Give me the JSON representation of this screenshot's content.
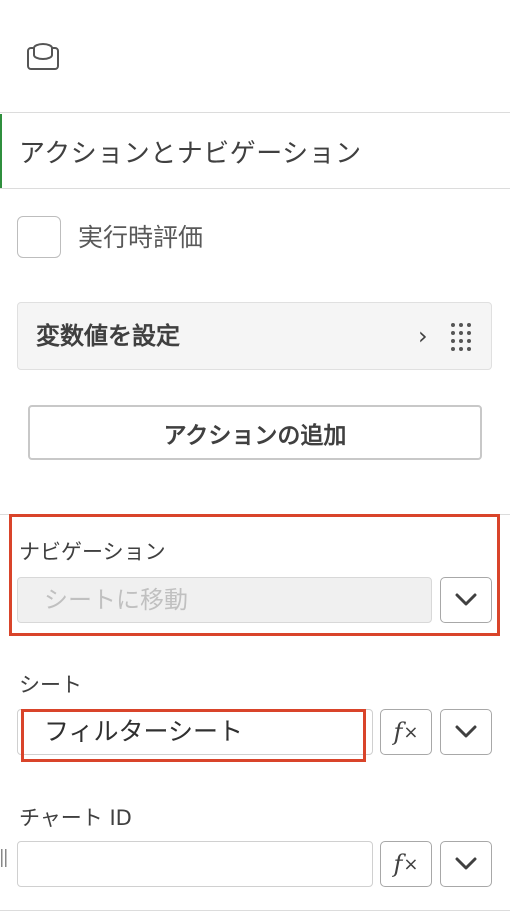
{
  "panel": {
    "top_icon": "database-icon",
    "section_title": "アクションとナビゲーション",
    "eval_checkbox_label": "実行時評価",
    "variable_card_label": "変数値を設定",
    "variable_card_chevron": "›",
    "add_action_button": "アクションの追加"
  },
  "navigation": {
    "label": "ナビゲーション",
    "select_value": "シートに移動"
  },
  "sheet": {
    "label": "シート",
    "value": "フィルターシート",
    "fx_label": "f",
    "fx_sub": "×"
  },
  "chart": {
    "label": "チャート ID",
    "value": "",
    "fx_label": "f",
    "fx_sub": "×"
  },
  "colors": {
    "accent_green": "#2f8f3d",
    "highlight_red": "#d9442a"
  }
}
